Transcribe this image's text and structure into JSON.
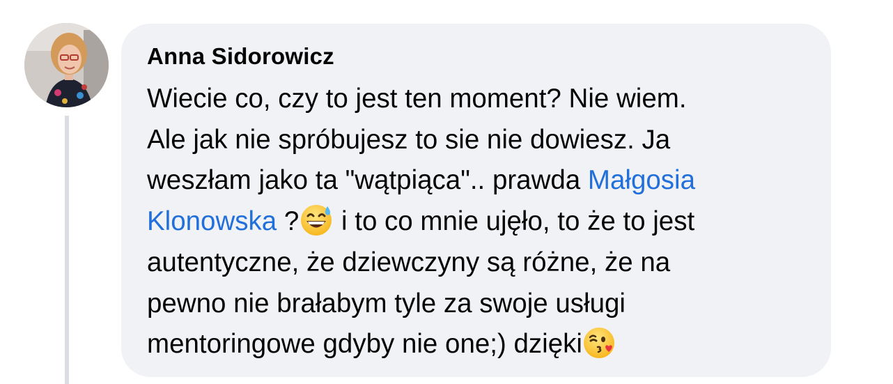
{
  "comment": {
    "author": "Anna Sidorowicz",
    "avatar_icon": "profile-photo",
    "lines": {
      "l1": "Wiecie co, czy to jest ten moment?  Nie wiem.",
      "l2": "Ale jak nie spróbujesz to sie nie dowiesz. Ja",
      "l3_text": "weszłam jako ta \"wątpiąca\".. prawda ",
      "l3_mention": "Małgosia",
      "l4_mention": "Klonowska",
      "l4_text_a": " ?",
      "l4_text_b": " i to co mnie ujęło, to że to jest",
      "l5": "autentyczne, że dziewczyny są różne, że na",
      "l6": "pewno nie brałabym tyle za swoje usługi",
      "l7": "mentoringowe gdyby nie one;) dzięki"
    },
    "emojis": {
      "first": "grinning-face-with-sweat-emoji",
      "second": "face-blowing-kiss-emoji"
    },
    "colors": {
      "bubble_bg": "#f0f2f5",
      "text": "#050505",
      "mention": "#216fdb",
      "thread_line": "#dadde1"
    }
  }
}
